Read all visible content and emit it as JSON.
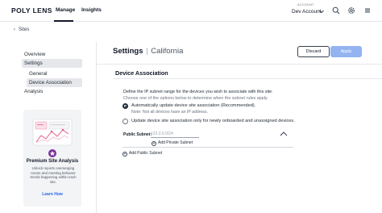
{
  "header": {
    "brand": "POLY LENS",
    "tabs": [
      {
        "label": "Manage",
        "active": true
      },
      {
        "label": "Insights",
        "active": false
      }
    ],
    "account_label": "ACCOUNT",
    "account_value": "Dev Account",
    "icons": [
      "search-icon",
      "gear-icon",
      "menu-icon"
    ]
  },
  "breadcrumb": {
    "back_label": "Sites"
  },
  "sidebar": {
    "items": [
      {
        "label": "Overview",
        "level": 0,
        "active": false
      },
      {
        "label": "Settings",
        "level": 0,
        "active": true
      },
      {
        "label": "General",
        "level": 1,
        "active": false
      },
      {
        "label": "Device Association",
        "level": 1,
        "active": true
      },
      {
        "label": "Analysis",
        "level": 0,
        "active": false
      }
    ]
  },
  "promo": {
    "title": "Premium Site Analysis",
    "description": "Unlock reports onemerging rooms and meeting behavior trends happening within each site.",
    "link": "Learn How"
  },
  "main": {
    "title": "Settings",
    "site_name": "California",
    "discard_label": "Discard",
    "apply_label": "Apply",
    "section_title": "Device Association",
    "intro_line1": "Define the IP subnet range for the devices you wish to associate with this site.",
    "intro_line2": "Choose one of the options below to determine when the subnet rules apply.",
    "options": [
      {
        "label": "Automatically update device site association (Recommended).",
        "note": "Note: Not all devices have an IP address.",
        "selected": true
      },
      {
        "label": "Update device site association only for newly onboarded and unassigned devices.",
        "selected": false
      }
    ],
    "public_subnet_label": "Public Subnet:",
    "public_subnet_placeholder": "123.0.0.0/24",
    "add_private_label": "Add Private Subnet",
    "add_public_label": "Add Public Subnet"
  },
  "colors": {
    "apply_button": "#93b4f0",
    "link": "#2563eb",
    "promo_badge": "#7b2fa0"
  }
}
